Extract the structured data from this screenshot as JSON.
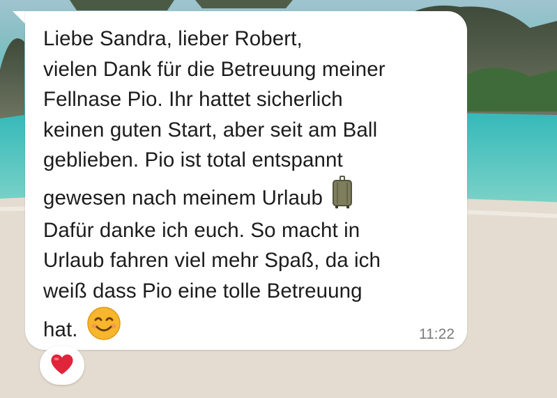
{
  "message": {
    "lines": [
      "Liebe Sandra, lieber Robert,",
      "vielen Dank für die Betreuung meiner",
      "Fellnase Pio. Ihr hattet sicherlich",
      "keinen guten Start, aber seit am Ball",
      "geblieben. Pio ist total entspannt",
      "gewesen nach meinem Urlaub",
      "Dafür danke ich euch. So macht in",
      "Urlaub fahren viel mehr Spaß, da ich",
      "weiß dass Pio eine tolle Betreuung",
      "hat."
    ],
    "inline_emojis": [
      "luggage-icon",
      "smiling-face-icon"
    ],
    "time": "11:22"
  },
  "reaction": {
    "icon": "red-heart-icon"
  },
  "colors": {
    "bubble": "#ffffff",
    "text": "#1c1c1c",
    "timestamp": "#7a7a7a",
    "heart": "#e0243a",
    "emoji_face": "#f7b62b"
  }
}
